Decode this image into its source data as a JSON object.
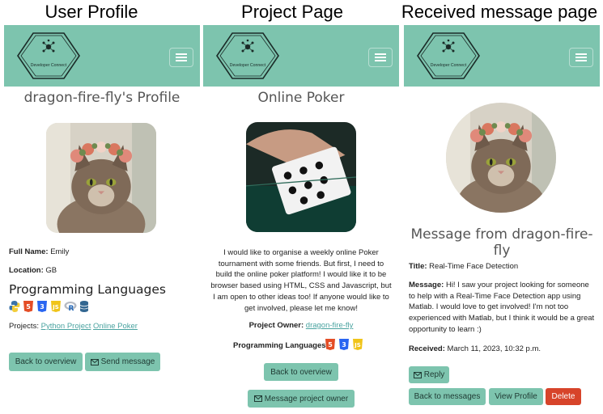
{
  "captions": [
    "User Profile",
    "Project Page",
    "Received message page"
  ],
  "brand": {
    "name": "Developer Connect"
  },
  "profile": {
    "title": "dragon-fire-fly's Profile",
    "full_name_label": "Full Name:",
    "full_name": "Emily",
    "location_label": "Location:",
    "location": "GB",
    "languages_heading": "Programming Languages",
    "language_icons": [
      "python-icon",
      "html5-icon",
      "css3-icon",
      "javascript-icon",
      "r-icon",
      "database-icon"
    ],
    "projects_label": "Projects:",
    "projects": [
      "Python Project",
      "Online Poker"
    ],
    "back_button": "Back to overview",
    "send_button": "Send message"
  },
  "project": {
    "title": "Online Poker",
    "description": "I would like to organise a weekly online Poker tournament with some friends. But first, I need to build the online poker platform! I would like it to be browser based using HTML, CSS and Javascript, but I am open to other ideas too! If anyone would like to get involved, please let me know!",
    "owner_label": "Project Owner:",
    "owner": "dragon-fire-fly",
    "languages_label": "Programming Languages:",
    "language_icons": [
      "html5-icon",
      "css3-icon",
      "javascript-icon"
    ],
    "back_button": "Back to overview",
    "message_button": "Message project owner"
  },
  "message": {
    "title": "Message from dragon-fire-fly",
    "subject_label": "Title:",
    "subject": "Real-Time Face Detection",
    "message_label": "Message:",
    "body": "Hi! I saw your project looking for someone to help with a Real-Time Face Detection app using Matlab. I would love to get involved! I'm not too experienced with Matlab, but I think it would be a great opportunity to learn :)",
    "received_label": "Received:",
    "received": "March 11, 2023, 10:32 p.m.",
    "reply_button": "Reply",
    "back_button": "Back to messages",
    "view_profile_button": "View Profile",
    "delete_button": "Delete"
  },
  "colors": {
    "navbar": "#7dc4ae",
    "button": "#7dc4ae",
    "link": "#4aa3a0",
    "danger": "#d7442a"
  }
}
